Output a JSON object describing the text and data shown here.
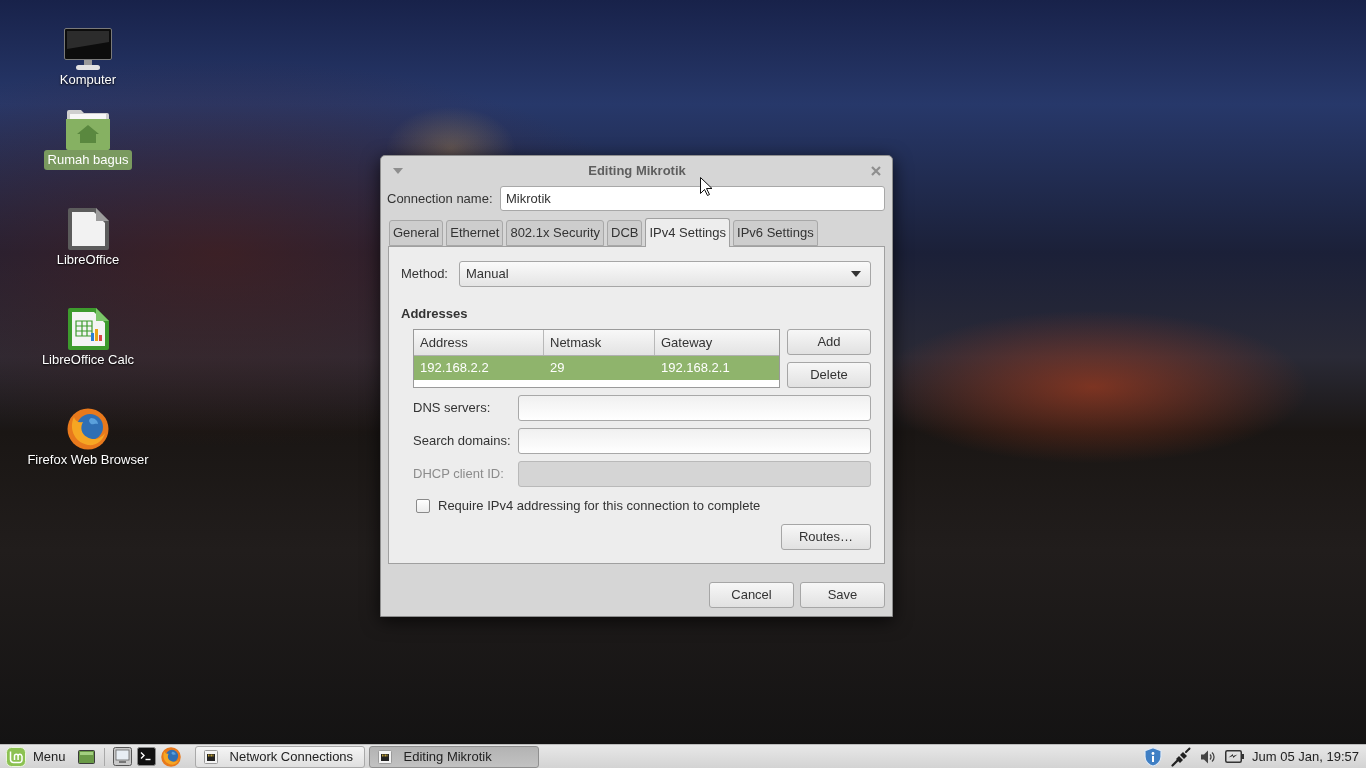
{
  "desktop": {
    "icons": [
      {
        "kind": "computer",
        "label": "Komputer",
        "selected": false
      },
      {
        "kind": "home-folder",
        "label": "Rumah bagus",
        "selected": true
      },
      {
        "kind": "office",
        "label": "LibreOffice",
        "selected": false
      },
      {
        "kind": "spreadsheet",
        "label": "LibreOffice Calc",
        "selected": false
      },
      {
        "kind": "browser",
        "label": "Firefox Web Browser",
        "selected": false
      }
    ]
  },
  "dialog": {
    "title": "Editing Mikrotik",
    "connection_name": {
      "label": "Connection name:",
      "value": "Mikrotik"
    },
    "tabs": [
      {
        "label": "General",
        "selected": false
      },
      {
        "label": "Ethernet",
        "selected": false
      },
      {
        "label": "802.1x Security",
        "selected": false
      },
      {
        "label": "DCB",
        "selected": false
      },
      {
        "label": "IPv4 Settings",
        "selected": true
      },
      {
        "label": "IPv6 Settings",
        "selected": false
      }
    ],
    "method": {
      "label": "Method:",
      "value": "Manual"
    },
    "addresses": {
      "heading": "Addresses",
      "columns": [
        "Address",
        "Netmask",
        "Gateway"
      ],
      "rows": [
        {
          "cells": [
            "192.168.2.2",
            "29",
            "192.168.2.1"
          ],
          "selected": true
        }
      ],
      "buttons": [
        "Add",
        "Delete"
      ]
    },
    "fields": [
      {
        "label": "DNS servers:",
        "disabled": false
      },
      {
        "label": "Search domains:",
        "disabled": false
      },
      {
        "label": "DHCP client ID:",
        "disabled": true
      }
    ],
    "require_ipv4": {
      "label": "Require IPv4 addressing for this connection to complete",
      "checked": false
    },
    "routes_button": "Routes…",
    "buttons": [
      "Cancel",
      "Save"
    ]
  },
  "taskbar": {
    "menu_label": "Menu",
    "windows": [
      {
        "title": "Network Connections",
        "selected": false
      },
      {
        "title": "Editing Mikrotik",
        "selected": true
      }
    ],
    "clock": "Jum 05 Jan, 19:57"
  }
}
